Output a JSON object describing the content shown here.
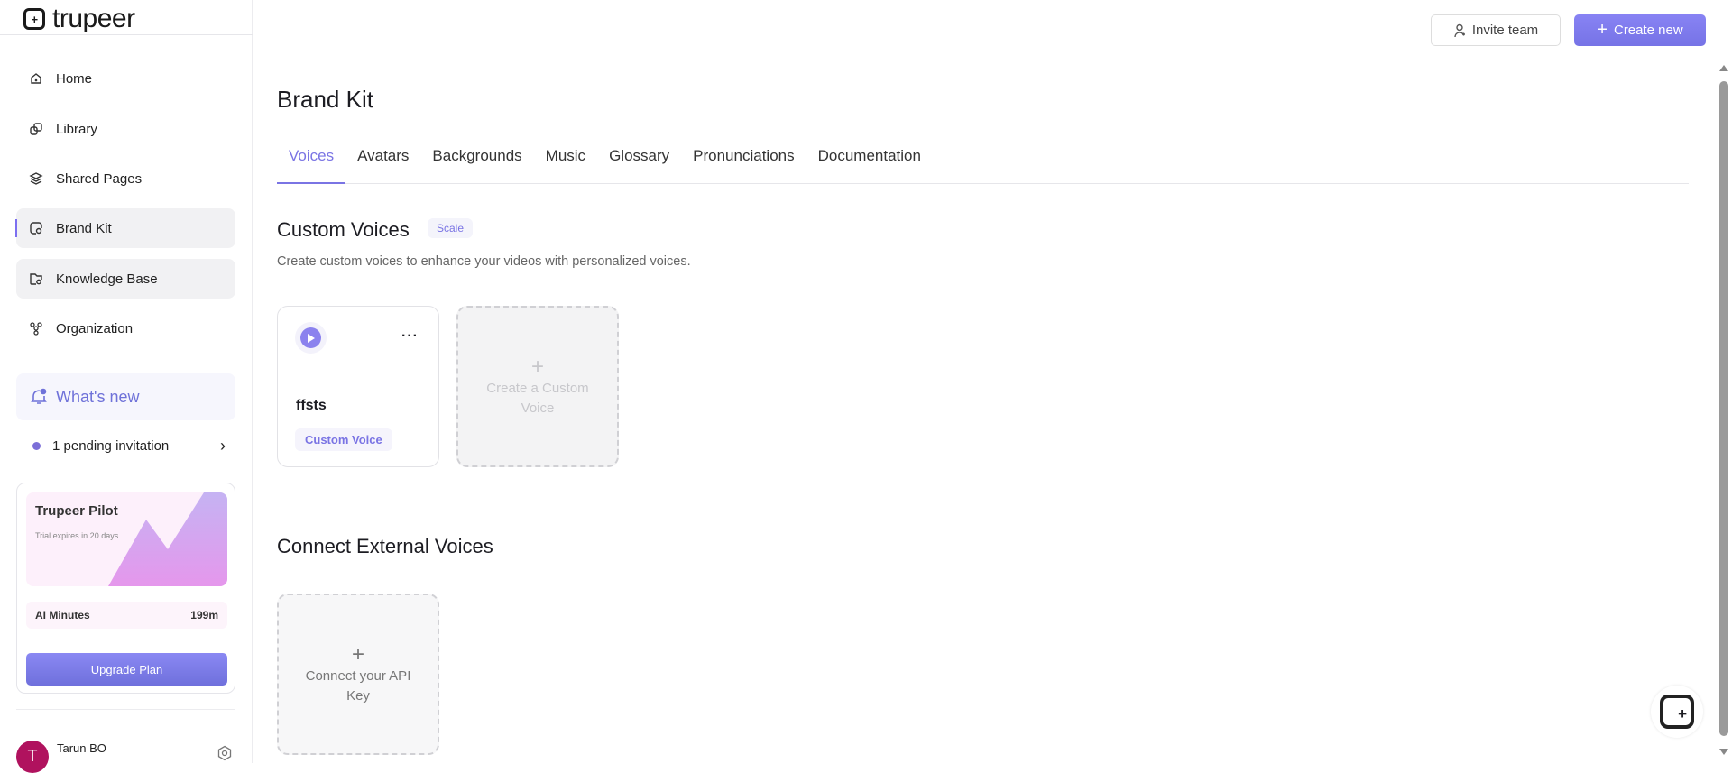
{
  "brand": "trupeer",
  "sidebar": {
    "items": [
      {
        "label": "Home"
      },
      {
        "label": "Library"
      },
      {
        "label": "Shared Pages"
      },
      {
        "label": "Brand Kit"
      },
      {
        "label": "Knowledge Base"
      },
      {
        "label": "Organization"
      }
    ],
    "whats_new": "What's new",
    "pending": "1 pending invitation",
    "pilot": {
      "title": "Trupeer Pilot",
      "subtitle": "Trial expires in 20 days",
      "minutes_label": "AI Minutes",
      "minutes_value": "199m",
      "upgrade": "Upgrade Plan"
    },
    "user": {
      "initial": "T",
      "name": "Tarun BO"
    }
  },
  "header": {
    "invite": "Invite team",
    "create": "Create new"
  },
  "page": {
    "title": "Brand Kit",
    "tabs": [
      "Voices",
      "Avatars",
      "Backgrounds",
      "Music",
      "Glossary",
      "Pronunciations",
      "Documentation"
    ],
    "custom": {
      "heading": "Custom Voices",
      "badge": "Scale",
      "description": "Create custom voices to enhance your videos with personalized voices.",
      "voice": {
        "name": "ffsts",
        "tag": "Custom Voice"
      },
      "create_label": "Create a Custom Voice"
    },
    "external": {
      "heading": "Connect External Voices",
      "connect_label": "Connect your API Key"
    }
  },
  "colors": {
    "accent": "#7a74e4",
    "avatar": "#b0125e"
  }
}
